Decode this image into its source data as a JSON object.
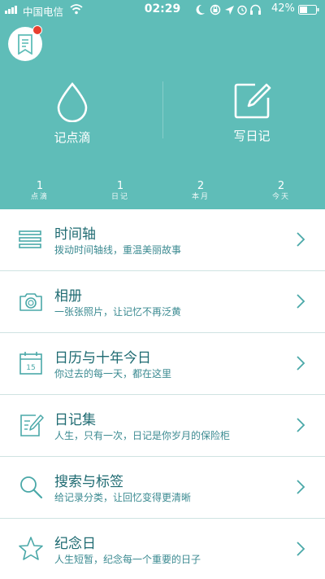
{
  "status_bar": {
    "carrier": "中国电信",
    "time": "02:29",
    "battery": "42%"
  },
  "actions": {
    "drop_label": "记点滴",
    "diary_label": "写日记"
  },
  "stats": [
    {
      "value": "1",
      "label": "点滴"
    },
    {
      "value": "1",
      "label": "日记"
    },
    {
      "value": "2",
      "label": "本月"
    },
    {
      "value": "2",
      "label": "今天"
    }
  ],
  "menu": [
    {
      "icon": "timeline-icon",
      "title": "时间轴",
      "subtitle": "拨动时间轴线，重温美丽故事"
    },
    {
      "icon": "camera-icon",
      "title": "相册",
      "subtitle": "一张张照片，让记忆不再泛黄"
    },
    {
      "icon": "calendar-icon",
      "title": "日历与十年今日",
      "subtitle": "你过去的每一天，都在这里"
    },
    {
      "icon": "notebook-pen-icon",
      "title": "日记集",
      "subtitle": "人生，只有一次，日记是你岁月的保险柜"
    },
    {
      "icon": "search-icon",
      "title": "搜索与标签",
      "subtitle": "给记录分类，让回忆变得更清晰"
    },
    {
      "icon": "star-icon",
      "title": "纪念日",
      "subtitle": "人生短暂，纪念每一个重要的日子"
    }
  ],
  "colors": {
    "header_bg": "#5fbdb8",
    "accent": "#1f6b72",
    "notification_dot": "#e8402f"
  },
  "calendar_icon_day": "15"
}
